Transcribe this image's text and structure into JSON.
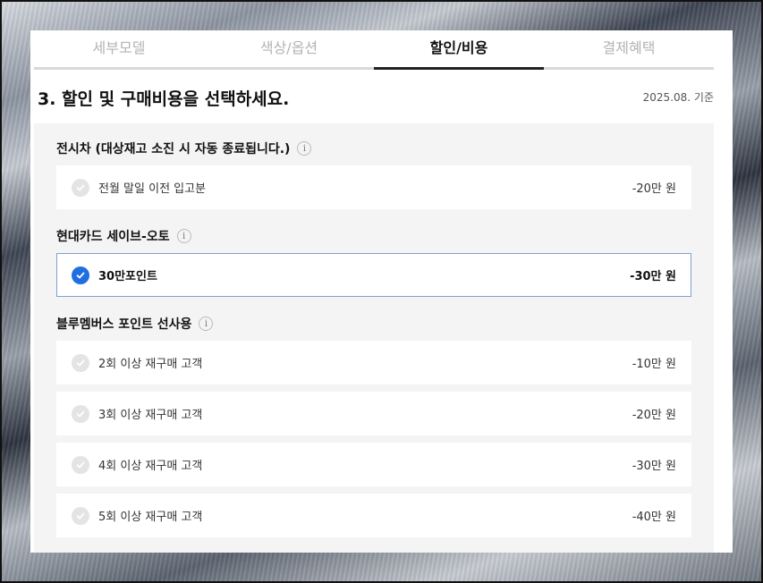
{
  "tabs": [
    {
      "label": "세부모델",
      "active": false
    },
    {
      "label": "색상/옵션",
      "active": false
    },
    {
      "label": "할인/비용",
      "active": true
    },
    {
      "label": "결제혜택",
      "active": false
    }
  ],
  "section": {
    "title": "3. 할인 및 구매비용을 선택하세요.",
    "base_date": "2025.08. 기준"
  },
  "groups": [
    {
      "title": "전시차 (대상재고 소진 시 자동 종료됩니다.)",
      "info_icon": "i",
      "options": [
        {
          "label": "전월 말일 이전 입고분",
          "price": "-20만 원",
          "selected": false
        }
      ]
    },
    {
      "title": "현대카드 세이브-오토",
      "info_icon": "i",
      "options": [
        {
          "label": "30만포인트",
          "price": "-30만 원",
          "selected": true
        }
      ]
    },
    {
      "title": "블루멤버스 포인트 선사용",
      "info_icon": "i",
      "options": [
        {
          "label": "2회 이상 재구매 고객",
          "price": "-10만 원",
          "selected": false
        },
        {
          "label": "3회 이상 재구매 고객",
          "price": "-20만 원",
          "selected": false
        },
        {
          "label": "4회 이상 재구매 고객",
          "price": "-30만 원",
          "selected": false
        },
        {
          "label": "5회 이상 재구매 고객",
          "price": "-40만 원",
          "selected": false
        }
      ]
    }
  ],
  "colors": {
    "accent": "#1f6fe0",
    "selected_border": "#7ea1d6",
    "content_bg": "#f4f4f4"
  },
  "icons": {
    "check": "check-icon",
    "info": "info-icon"
  }
}
